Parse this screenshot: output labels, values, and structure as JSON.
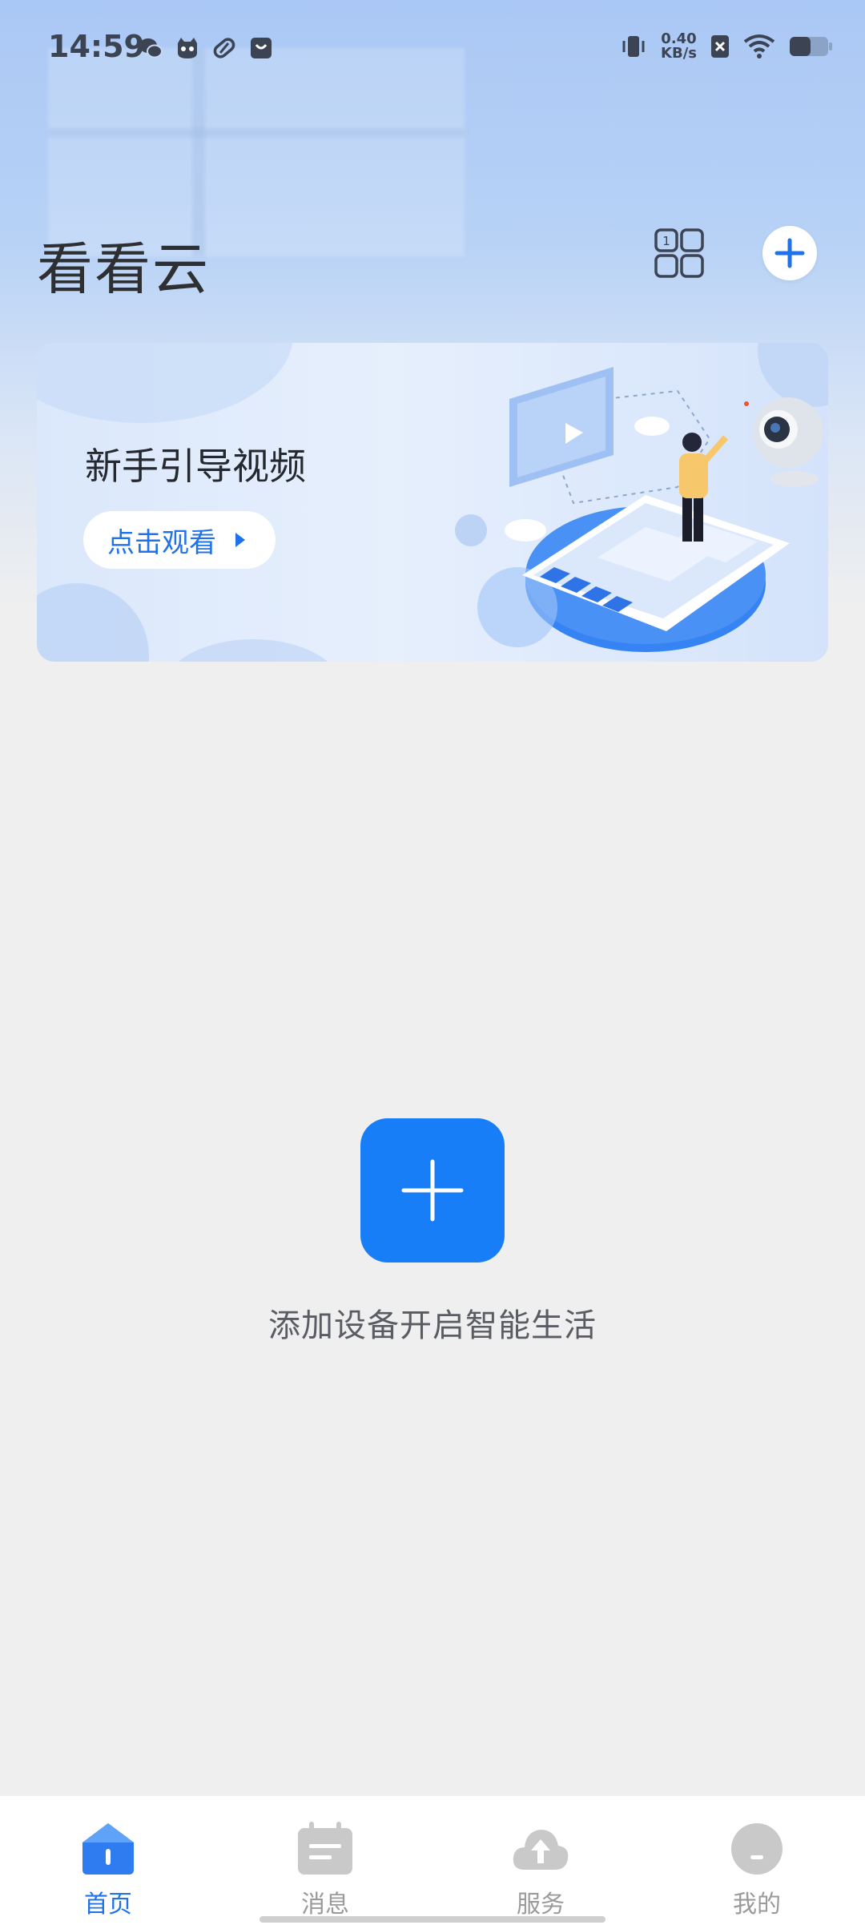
{
  "status_bar": {
    "time": "14:59",
    "speed_value": "0.40",
    "speed_unit": "KB/s",
    "icons_left": [
      "wechat-icon",
      "cat-app-icon",
      "capsule-icon",
      "shopping-bag-icon"
    ],
    "icons_right": [
      "vibrate-icon",
      "network-speed",
      "sim-off-icon",
      "wifi-icon",
      "battery-icon"
    ]
  },
  "header": {
    "title": "看看云",
    "grid_icon": "grid-layout-icon",
    "add_icon": "plus-icon"
  },
  "banner": {
    "title": "新手引导视频",
    "button_label": "点击观看"
  },
  "empty_state": {
    "text": "添加设备开启智能生活"
  },
  "bottom_nav": {
    "items": [
      {
        "label": "首页",
        "icon": "home-icon",
        "active": true
      },
      {
        "label": "消息",
        "icon": "calendar-message-icon",
        "active": false
      },
      {
        "label": "服务",
        "icon": "cloud-upload-icon",
        "active": false
      },
      {
        "label": "我的",
        "icon": "profile-icon",
        "active": false
      }
    ]
  },
  "colors": {
    "accent": "#177ef8",
    "accent_text": "#1f72e9",
    "background": "#efefef",
    "nav_inactive": "#9a9a9a"
  }
}
